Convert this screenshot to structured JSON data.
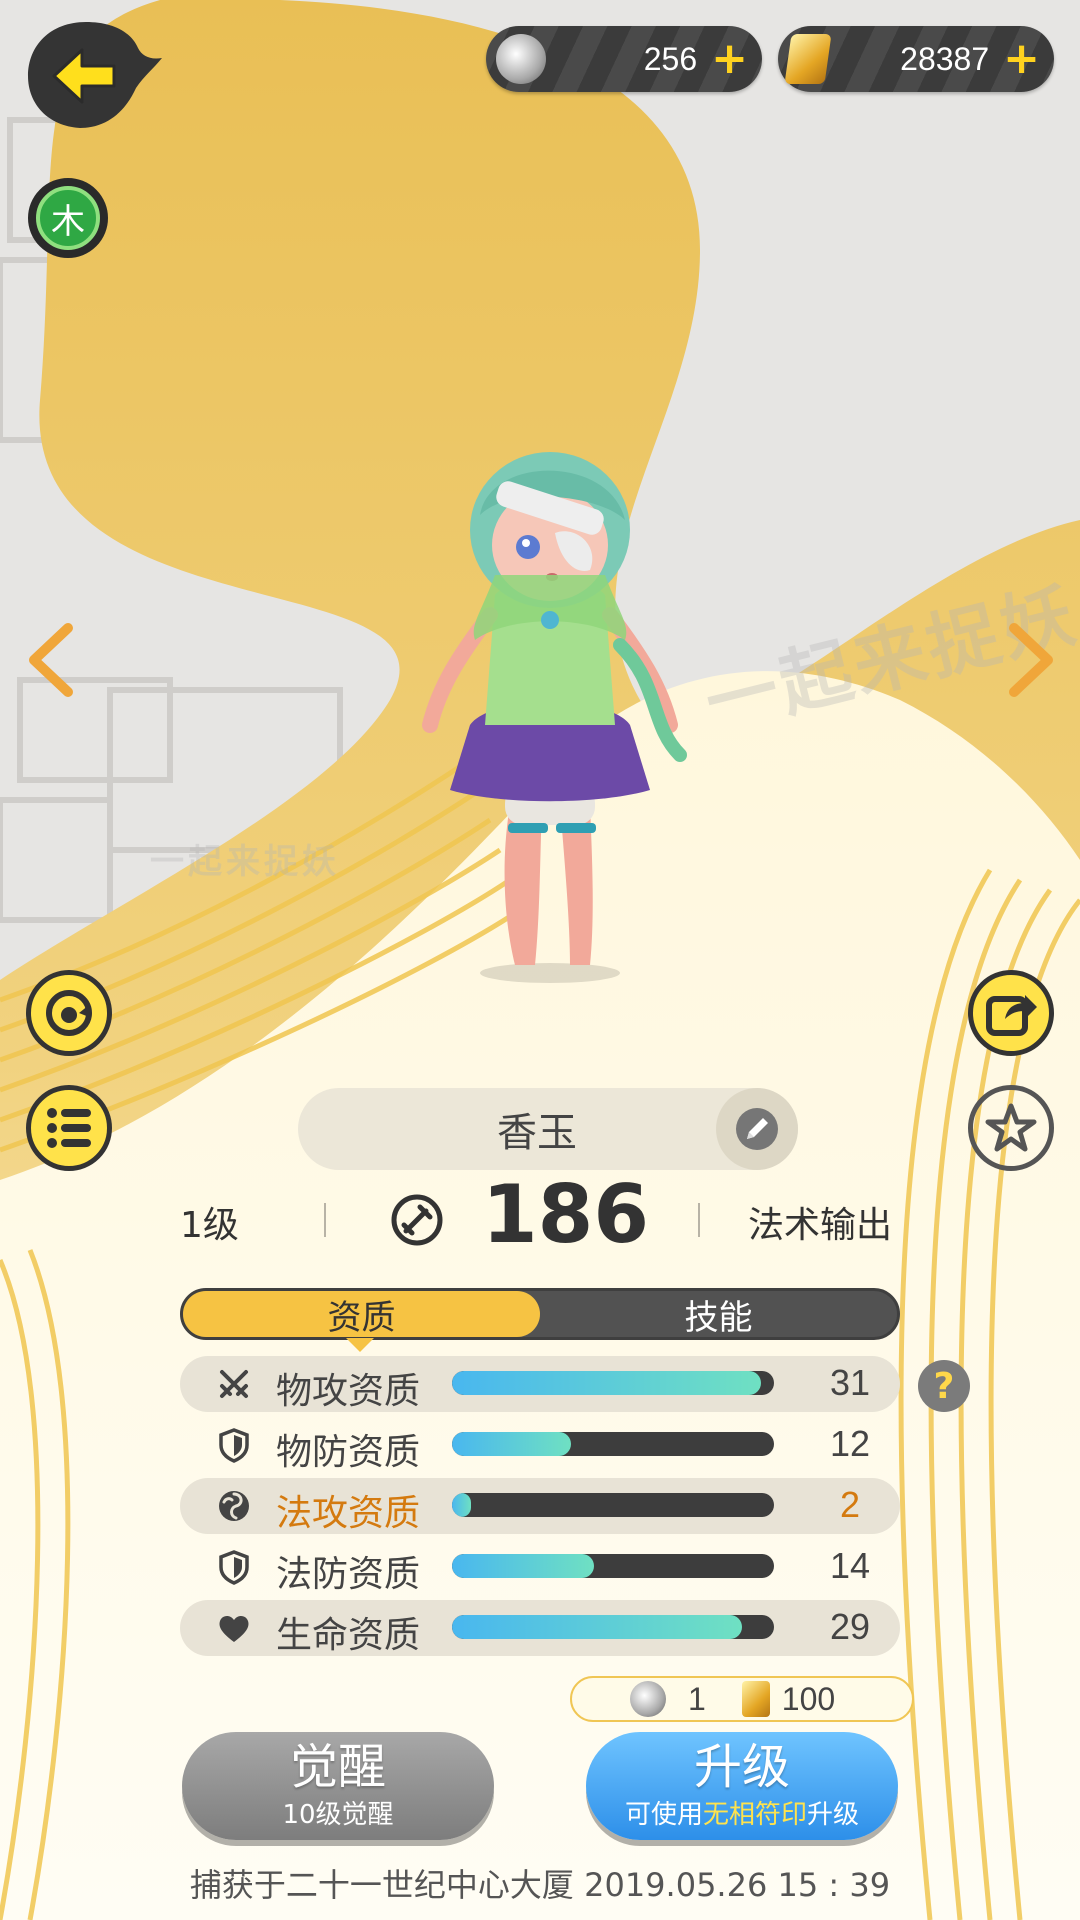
{
  "header": {
    "currency_pearl": "256",
    "currency_crystal": "28387",
    "element_badge": "木"
  },
  "background": {
    "watermark_1": "一起来捉妖",
    "watermark_2": "一起来捉妖"
  },
  "pet": {
    "name": "香玉",
    "level": "1级",
    "power": "186",
    "role": "法术输出"
  },
  "tabs": [
    {
      "label": "资质",
      "active": true
    },
    {
      "label": "技能",
      "active": false
    }
  ],
  "aptitudes": [
    {
      "label": "物攻资质",
      "value": "31",
      "fill": 0.96,
      "icon": "swords-icon"
    },
    {
      "label": "物防资质",
      "value": "12",
      "fill": 0.37,
      "icon": "shield-icon"
    },
    {
      "label": "法攻资质",
      "value": "2",
      "fill": 0.06,
      "icon": "swirl-icon"
    },
    {
      "label": "法防资质",
      "value": "14",
      "fill": 0.44,
      "icon": "shield-icon"
    },
    {
      "label": "生命资质",
      "value": "29",
      "fill": 0.9,
      "icon": "heart-icon"
    }
  ],
  "help": "?",
  "cost": {
    "pearl": "1",
    "crystal": "100"
  },
  "actions": {
    "awaken_title": "觉醒",
    "awaken_sub": "10级觉醒",
    "upgrade_title": "升级",
    "upgrade_sub_prefix": "可使用",
    "upgrade_sub_highlight": "无相符印",
    "upgrade_sub_suffix": "升级"
  },
  "capture_info": "捕获于二十一世纪中心大厦  2019.05.26   15 : 39",
  "colors": {
    "accent_yellow": "#f6c343",
    "button_blue": "#2d8fe9",
    "highlight_orange": "#d47a0f"
  }
}
